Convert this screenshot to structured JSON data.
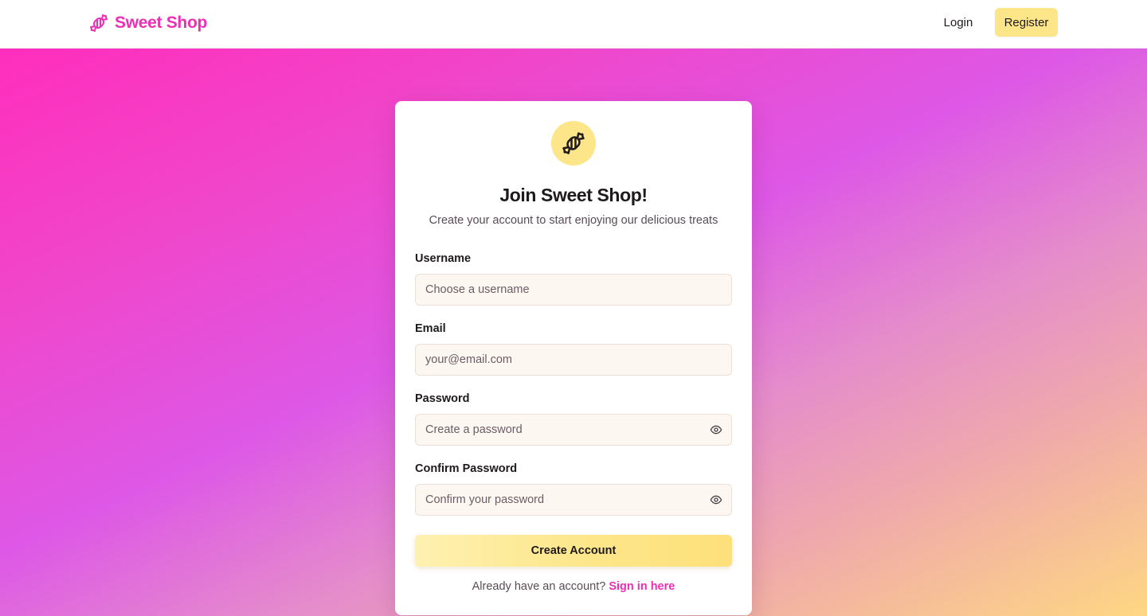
{
  "header": {
    "brand_name": "Sweet Shop",
    "brand_icon": "candy-icon",
    "brand_color": "#ec2fb3",
    "nav": {
      "login_label": "Login",
      "register_label": "Register"
    }
  },
  "card": {
    "badge_icon": "candy-icon",
    "title": "Join Sweet Shop!",
    "subtitle": "Create your account to start enjoying our delicious treats",
    "fields": {
      "username": {
        "label": "Username",
        "placeholder": "Choose a username",
        "value": ""
      },
      "email": {
        "label": "Email",
        "placeholder": "your@email.com",
        "value": ""
      },
      "password": {
        "label": "Password",
        "placeholder": "Create a password",
        "value": "",
        "toggle_icon": "eye-icon"
      },
      "confirm_password": {
        "label": "Confirm Password",
        "placeholder": "Confirm your password",
        "value": "",
        "toggle_icon": "eye-icon"
      }
    },
    "submit_label": "Create Account",
    "signin_prompt": "Already have an account?",
    "signin_link": "Sign in here"
  },
  "colors": {
    "accent_pink": "#ec2fb3",
    "accent_yellow": "#fde68a",
    "input_background": "#fdf7f2"
  }
}
